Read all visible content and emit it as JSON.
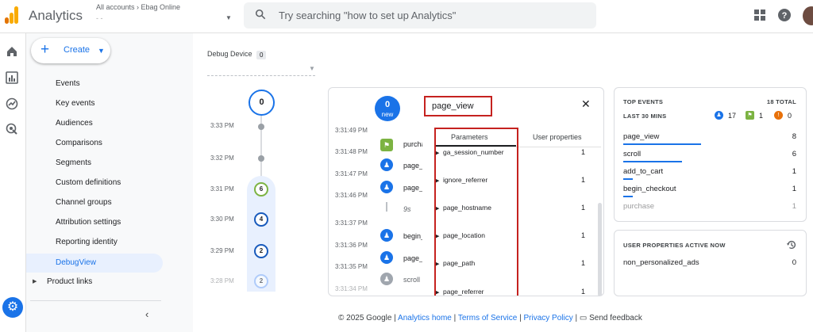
{
  "topbar": {
    "brand": "Analytics",
    "account_path": "All accounts › Ebag Online",
    "account_sub": "- -",
    "search_placeholder": "Try searching \"how to set up Analytics\""
  },
  "nav": {
    "create_label": "Create",
    "items": [
      {
        "label": "Events"
      },
      {
        "label": "Key events"
      },
      {
        "label": "Audiences"
      },
      {
        "label": "Comparisons"
      },
      {
        "label": "Segments"
      },
      {
        "label": "Custom definitions"
      },
      {
        "label": "Channel groups"
      },
      {
        "label": "Attribution settings"
      },
      {
        "label": "Reporting identity"
      },
      {
        "label": "DebugView"
      },
      {
        "label": "Product links"
      }
    ]
  },
  "debug": {
    "device_label": "Debug Device",
    "device_count": "0"
  },
  "timeline": {
    "top_count": "0",
    "rows": [
      {
        "time": "3:33 PM",
        "count": ""
      },
      {
        "time": "3:32 PM",
        "count": ""
      },
      {
        "time": "3:31 PM",
        "count": "6"
      },
      {
        "time": "3:30 PM",
        "count": "4"
      },
      {
        "time": "3:29 PM",
        "count": "2"
      },
      {
        "time": "3:28 PM",
        "count": "2"
      }
    ]
  },
  "stream": {
    "new_count": "0",
    "new_label": "new",
    "gap": "9s",
    "events": [
      {
        "time": "3:31:49 PM",
        "name": ""
      },
      {
        "time": "3:31:48 PM",
        "name": "purchase"
      },
      {
        "time": "3:31:47 PM",
        "name": "page_view"
      },
      {
        "time": "3:31:46 PM",
        "name": "page_view"
      },
      {
        "time": "3:31:37 PM",
        "name": ""
      },
      {
        "time": "3:31:36 PM",
        "name": "begin_checkout"
      },
      {
        "time": "3:31:35 PM",
        "name": "page_view"
      },
      {
        "time": "3:31:34 PM",
        "name": "scroll"
      }
    ]
  },
  "detail": {
    "title": "page_view",
    "tab_params": "Parameters",
    "tab_user": "User properties",
    "params": [
      {
        "name": "ga_session_number",
        "value": "1"
      },
      {
        "name": "ignore_referrer",
        "value": "1"
      },
      {
        "name": "page_hostname",
        "value": "1"
      },
      {
        "name": "page_location",
        "value": "1"
      },
      {
        "name": "page_path",
        "value": "1"
      },
      {
        "name": "page_referrer",
        "value": "1"
      }
    ]
  },
  "top_events": {
    "heading": "TOP EVENTS",
    "total": "18 TOTAL",
    "period": "LAST 30 MINS",
    "badge_blue": "17",
    "badge_green": "1",
    "badge_orange": "0",
    "rows": [
      {
        "name": "page_view",
        "count": "8"
      },
      {
        "name": "scroll",
        "count": "6"
      },
      {
        "name": "add_to_cart",
        "count": "1"
      },
      {
        "name": "begin_checkout",
        "count": "1"
      },
      {
        "name": "purchase",
        "count": "1"
      }
    ]
  },
  "user_props": {
    "heading": "USER PROPERTIES ACTIVE NOW",
    "rows": [
      {
        "name": "non_personalized_ads",
        "count": "0"
      }
    ]
  },
  "footer": {
    "copyright": "© 2025 Google |",
    "home": "Analytics home",
    "sep1": "|",
    "tos": "Terms of Service",
    "sep2": "|",
    "privacy": "Privacy Policy",
    "sep3": "|",
    "feedback": "Send feedback"
  },
  "colors": {
    "accent": "#1a73e8",
    "highlight_box": "#c5221f",
    "logo": "#f9ab00"
  }
}
